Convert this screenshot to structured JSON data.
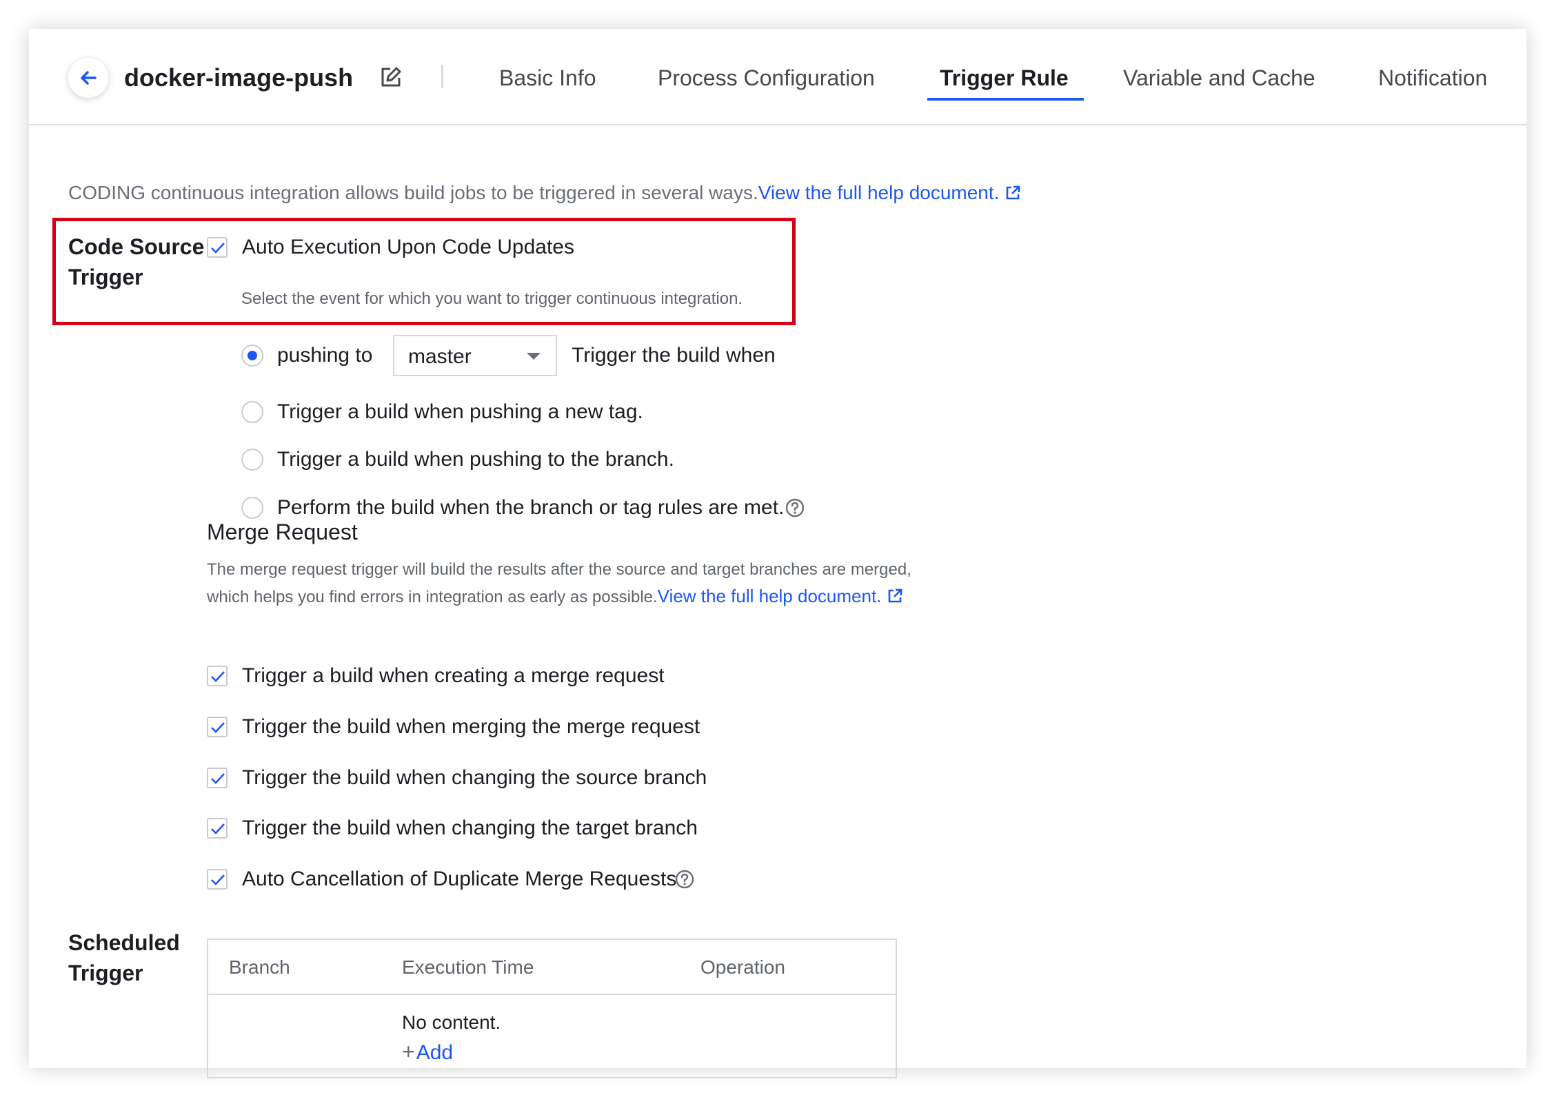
{
  "header": {
    "job_name": "docker-image-push",
    "tabs": [
      {
        "label": "Basic Info",
        "active": false
      },
      {
        "label": "Process Configuration",
        "active": false
      },
      {
        "label": "Trigger Rule",
        "active": true
      },
      {
        "label": "Variable and Cache",
        "active": false
      },
      {
        "label": "Notification",
        "active": false
      }
    ]
  },
  "intro": {
    "text": "CODING continuous integration allows build jobs to be triggered in several ways.",
    "link": "View the full help document."
  },
  "code_source": {
    "label_line1": "Code Source",
    "label_line2": "Trigger",
    "auto_exec_label": "Auto Execution Upon Code Updates",
    "auto_exec_checked": true,
    "hint": "Select the event for which you want to trigger continuous integration.",
    "options": [
      {
        "label": "pushing to",
        "selected": true
      },
      {
        "label": "Trigger a build when pushing a new tag.",
        "selected": false
      },
      {
        "label": "Trigger a build when pushing to the branch.",
        "selected": false
      },
      {
        "label": "Perform the build when the branch or tag rules are met.",
        "selected": false
      }
    ],
    "branch_select_value": "master",
    "after_select_text": "Trigger the build when"
  },
  "merge_request": {
    "title": "Merge Request",
    "desc_line1": "The merge request trigger will build the results after the source and target branches are merged,",
    "desc_line2": "which helps you find errors in integration as early as possible.",
    "desc_link": "View the full help document.",
    "options": [
      {
        "label": "Trigger a build when creating a merge request",
        "checked": true
      },
      {
        "label": "Trigger the build when merging the merge request",
        "checked": true
      },
      {
        "label": "Trigger the build when changing the source branch",
        "checked": true
      },
      {
        "label": "Trigger the build when changing the target branch",
        "checked": true
      },
      {
        "label": "Auto Cancellation of Duplicate Merge Requests",
        "checked": true
      }
    ]
  },
  "scheduled": {
    "label_line1": "Scheduled",
    "label_line2": "Trigger",
    "columns": [
      "Branch",
      "Execution Time",
      "Operation"
    ],
    "empty_text": "No content.",
    "add_label": "Add"
  },
  "colors": {
    "accent": "#1b57f5",
    "highlight": "#d20014",
    "border": "#d7d9df"
  }
}
